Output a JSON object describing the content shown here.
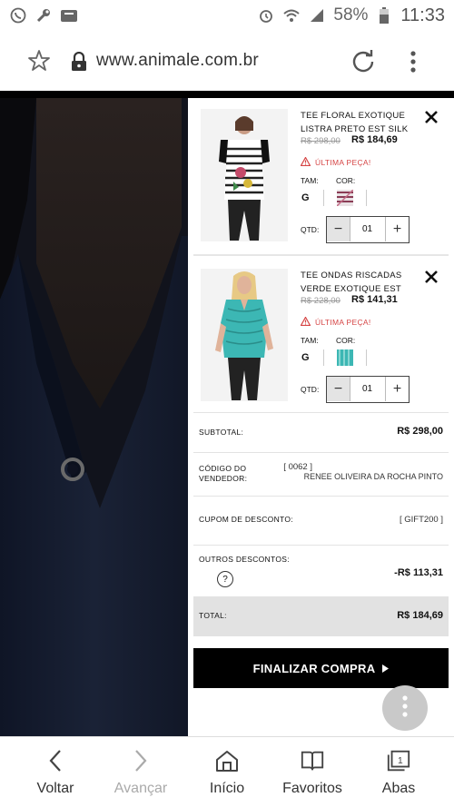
{
  "status_bar": {
    "battery_percent": "58%",
    "time": "11:33",
    "icons_left": [
      "whatsapp-icon",
      "wrench-icon",
      "sd-card-icon"
    ],
    "icons_right": [
      "alarm-icon",
      "wifi-icon",
      "signal-icon",
      "battery-icon"
    ]
  },
  "browser": {
    "url": "www.animale.com.br",
    "icons": [
      "star-icon",
      "lock-icon",
      "reload-icon",
      "more-vert-icon"
    ]
  },
  "cart": {
    "items": [
      {
        "name": "TEE FLORAL EXOTIQUE LISTRA PRETO EST SILK",
        "old_price": "R$ 298,00",
        "new_price": "R$ 184,69",
        "warning": "ÚLTIMA PEÇA!",
        "size_label": "TAM:",
        "color_label": "COR:",
        "size": "G",
        "qty_label": "QTD:",
        "qty": "01",
        "minus": "−",
        "plus": "+"
      },
      {
        "name": "TEE ONDAS RISCADAS VERDE EXOTIQUE EST",
        "old_price": "R$ 228,00",
        "new_price": "R$ 141,31",
        "warning": "ÚLTIMA PEÇA!",
        "size_label": "TAM:",
        "color_label": "COR:",
        "size": "G",
        "qty_label": "QTD:",
        "qty": "01",
        "minus": "−",
        "plus": "+"
      }
    ],
    "summary": {
      "subtotal_label": "SUBTOTAL:",
      "subtotal_value": "R$ 298,00",
      "seller_label": "CÓDIGO DO VENDEDOR:",
      "seller_code": "[ 0062 ]",
      "seller_name": "RENEE OLIVEIRA DA ROCHA PINTO",
      "coupon_label": "CUPOM DE DESCONTO:",
      "coupon_value": "[ GIFT200 ]",
      "other_discounts_label": "OUTROS DESCONTOS:",
      "other_discounts_value": "-R$ 113,31",
      "help": "?",
      "total_label": "TOTAL:",
      "total_value": "R$ 184,69"
    },
    "checkout_label": "FINALIZAR COMPRA"
  },
  "bottom_nav": [
    {
      "label": "Voltar",
      "icon": "chevron-left-icon"
    },
    {
      "label": "Avançar",
      "icon": "chevron-right-icon"
    },
    {
      "label": "Início",
      "icon": "home-icon"
    },
    {
      "label": "Favoritos",
      "icon": "book-icon"
    },
    {
      "label": "Abas",
      "icon": "tabs-icon"
    }
  ],
  "tabs_count": "1",
  "colors": {
    "accent": "#000000",
    "warning": "#d64545",
    "item2_swatch": "#3cb7b4"
  }
}
